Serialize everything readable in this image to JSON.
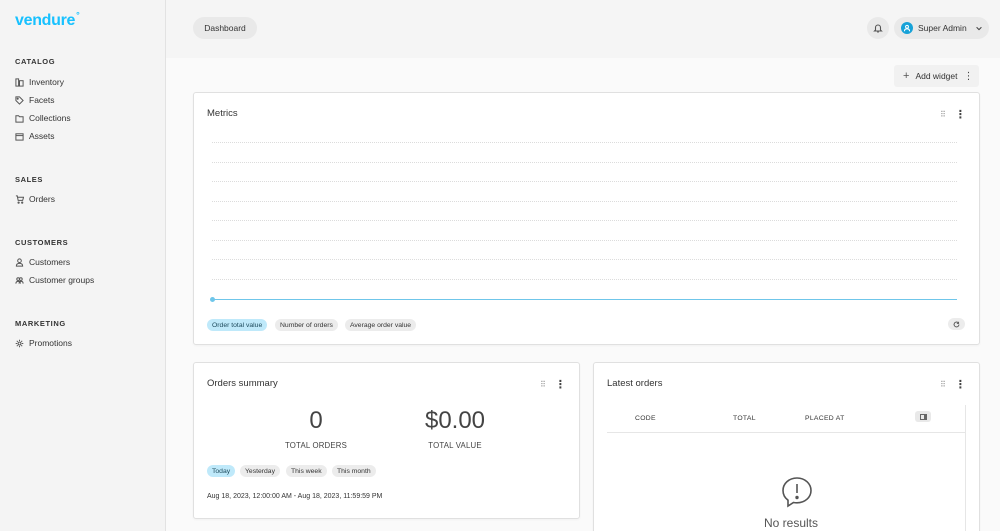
{
  "brand": {
    "logo_text": "vendure",
    "color": "#17c1ff"
  },
  "sidebar": {
    "sections": [
      {
        "label": "CATALOG",
        "items": [
          {
            "label": "Inventory",
            "icon": "inventory-icon"
          },
          {
            "label": "Facets",
            "icon": "tag-icon"
          },
          {
            "label": "Collections",
            "icon": "folder-icon"
          },
          {
            "label": "Assets",
            "icon": "assets-icon"
          }
        ]
      },
      {
        "label": "SALES",
        "items": [
          {
            "label": "Orders",
            "icon": "cart-icon"
          }
        ]
      },
      {
        "label": "CUSTOMERS",
        "items": [
          {
            "label": "Customers",
            "icon": "user-icon"
          },
          {
            "label": "Customer groups",
            "icon": "users-icon"
          }
        ]
      },
      {
        "label": "MARKETING",
        "items": [
          {
            "label": "Promotions",
            "icon": "gear-icon"
          }
        ]
      }
    ]
  },
  "header": {
    "breadcrumb": "Dashboard",
    "user_name": "Super Admin"
  },
  "toolbar": {
    "add_widget_label": "Add widget"
  },
  "metrics": {
    "title": "Metrics",
    "tabs": [
      "Order total value",
      "Number of orders",
      "Average order value"
    ],
    "active_tab": "Order total value",
    "accent_color": "#6fc6ea"
  },
  "chart_data": {
    "type": "line",
    "title": "Metrics",
    "series": [
      {
        "name": "Order total value",
        "values": [
          0
        ]
      }
    ],
    "grid": true
  },
  "orders_summary": {
    "title": "Orders summary",
    "total_orders": "0",
    "total_orders_label": "TOTAL ORDERS",
    "total_value": "$0.00",
    "total_value_label": "TOTAL VALUE",
    "ranges": [
      "Today",
      "Yesterday",
      "This week",
      "This month"
    ],
    "active_range": "Today",
    "date_range": "Aug 18, 2023, 12:00:00 AM - Aug 18, 2023, 11:59:59 PM"
  },
  "latest_orders": {
    "title": "Latest orders",
    "columns": [
      "CODE",
      "TOTAL",
      "PLACED AT"
    ],
    "empty_text": "No results"
  }
}
